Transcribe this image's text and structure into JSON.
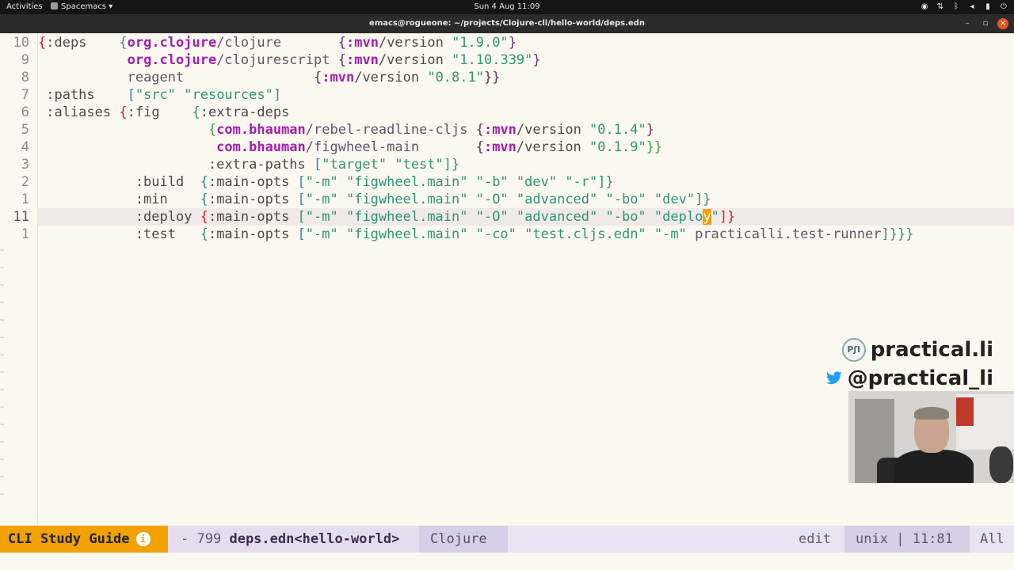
{
  "topbar": {
    "activities": "Activities",
    "app_menu": "Spacemacs ▾",
    "clock": "Sun 4 Aug  11:09",
    "tray_icons": [
      "screen-record-icon",
      "network-icon",
      "bluetooth-icon",
      "volume-icon",
      "battery-icon",
      "power-icon"
    ]
  },
  "window": {
    "title": "emacs@rogueone: ~/projects/Clojure-cli/hello-world/deps.edn",
    "minimize": "–",
    "maximize": "▫",
    "close": "×"
  },
  "gutter": {
    "line_numbers": [
      "10",
      "9",
      "8",
      "7",
      "6",
      "5",
      "4",
      "3",
      "2",
      "1",
      "11",
      "1"
    ],
    "current_index": 10
  },
  "code": {
    "l0": {
      "a": "{",
      "b": ":deps",
      "c": "    {",
      "d": "org.clojure",
      "e": "/clojure       ",
      "f": "{",
      "g": ":mvn",
      "h": "/version ",
      "i": "\"1.9.0\"",
      "j": "}"
    },
    "l1": {
      "a": "           ",
      "d": "org.clojure",
      "e": "/clojurescript ",
      "f": "{",
      "g": ":mvn",
      "h": "/version ",
      "i": "\"1.10.339\"",
      "j": "}"
    },
    "l2": {
      "a": "           ",
      "e": "reagent                ",
      "f": "{",
      "g": ":mvn",
      "h": "/version ",
      "i": "\"0.8.1\"",
      "j": "}}"
    },
    "l3": {
      "a": " :paths    ",
      "b": "[",
      "c": "\"src\" \"resources\"",
      "d": "]"
    },
    "l4": {
      "a": " :aliases ",
      "b": "{",
      "c": ":fig",
      "d": "    {",
      "e": ":extra-deps"
    },
    "l5": {
      "a": "                     ",
      "b": "{",
      "c": "com.bhauman",
      "d": "/rebel-readline-cljs ",
      "e": "{",
      "f": ":mvn",
      "g": "/version ",
      "h": "\"0.1.4\"",
      "i": "}"
    },
    "l6": {
      "a": "                      ",
      "c": "com.bhauman",
      "d": "/figwheel-main       ",
      "e": "{",
      "f": ":mvn",
      "g": "/version ",
      "h": "\"0.1.9\"",
      "i": "}}"
    },
    "l7": {
      "a": "                     ",
      "b": ":extra-paths ",
      "c": "[",
      "d": "\"target\" \"test\"",
      "e": "]}"
    },
    "l8": {
      "a": "            :build  ",
      "b": "{",
      "c": ":main-opts ",
      "d": "[",
      "e": "\"-m\" \"figwheel.main\" \"-b\" \"dev\" \"-r\"",
      "f": "]}"
    },
    "l9": {
      "a": "            :min    ",
      "b": "{",
      "c": ":main-opts ",
      "d": "[",
      "e": "\"-m\" \"figwheel.main\" \"-O\" \"advanced\" \"-bo\" \"dev\"",
      "f": "]}"
    },
    "l10": {
      "a": "            :deploy ",
      "b": "{",
      "c": ":main-opts ",
      "d": "[",
      "e": "\"-m\" \"figwheel.main\" \"-O\" \"advanced\" \"-bo\" \"deplo",
      "cur": "y",
      "g": "\"",
      "f": "]}"
    },
    "l11": {
      "a": "            :test   ",
      "b": "{",
      "c": ":main-opts ",
      "d": "[",
      "e": "\"-m\" \"figwheel.main\" \"-co\" \"test.cljs.edn\" \"-m\" ",
      "g": "practicalli.test-runner",
      "f": "]}}}"
    }
  },
  "branding": {
    "logo_text": "PʃI",
    "site": "practical.li",
    "handle": "@practical_li"
  },
  "modeline": {
    "perspective": "CLI Study Guide",
    "info_icon": "i",
    "state": "-",
    "size": "799",
    "buffer": "deps.edn<hello-world>",
    "major_mode": "Clojure",
    "edit_state": "edit",
    "eol": "unix",
    "sep": "|",
    "position": "11:81",
    "scroll": "All"
  },
  "colors": {
    "background": "#fbf8ef",
    "modeline_accent": "#f2a200",
    "namespace": "#a31db1",
    "string": "#2d9574"
  }
}
